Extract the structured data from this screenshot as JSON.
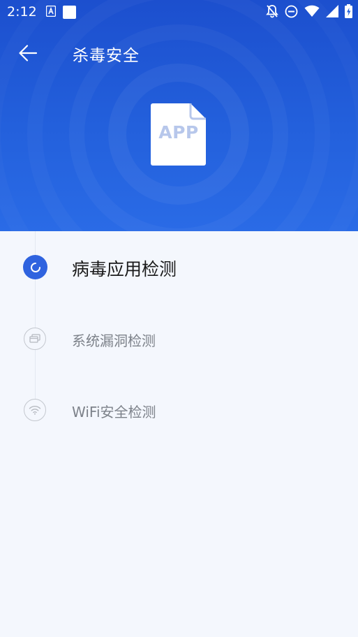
{
  "status_bar": {
    "time": "2:12"
  },
  "toolbar": {
    "title": "杀毒安全"
  },
  "hero": {
    "doc_label": "APP"
  },
  "scan_steps": [
    {
      "label": "病毒应用检测",
      "state": "active",
      "icon": "loading-spinner-icon"
    },
    {
      "label": "系统漏洞检测",
      "state": "pending",
      "icon": "system-window-icon"
    },
    {
      "label": "WiFi安全检测",
      "state": "pending",
      "icon": "wifi-icon"
    }
  ],
  "colors": {
    "header_blue": "#1c4fce",
    "accent_blue": "#2f63df",
    "background": "#f4f7fd",
    "pending_text": "#7d828a"
  }
}
